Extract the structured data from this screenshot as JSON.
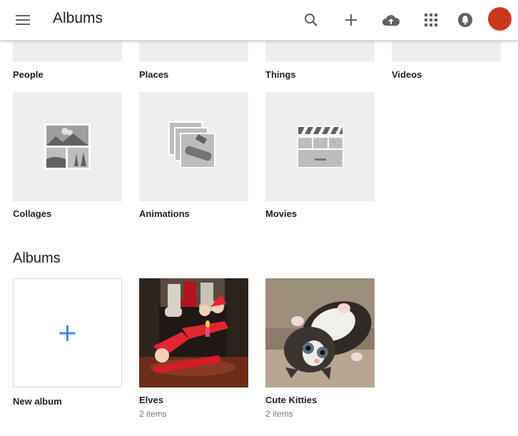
{
  "header": {
    "title": "Albums",
    "icons": [
      "menu-icon",
      "search-icon",
      "plus-icon",
      "cloud-upload-icon",
      "apps-grid-icon",
      "notifications-icon"
    ],
    "avatar_color": "#c9381c"
  },
  "categories": {
    "people": "People",
    "places": "Places",
    "things": "Things",
    "videos": "Videos"
  },
  "creations": {
    "collages": "Collages",
    "animations": "Animations",
    "movies": "Movies"
  },
  "albums_section": {
    "title": "Albums",
    "new_album": "New album",
    "items": [
      {
        "name": "Elves",
        "count": "2 items"
      },
      {
        "name": "Cute Kitties",
        "count": "2 items"
      }
    ]
  },
  "colors": {
    "accent_blue": "#4285f4",
    "tile_gray": "#eeeeee",
    "icon_gray": "#757575"
  }
}
